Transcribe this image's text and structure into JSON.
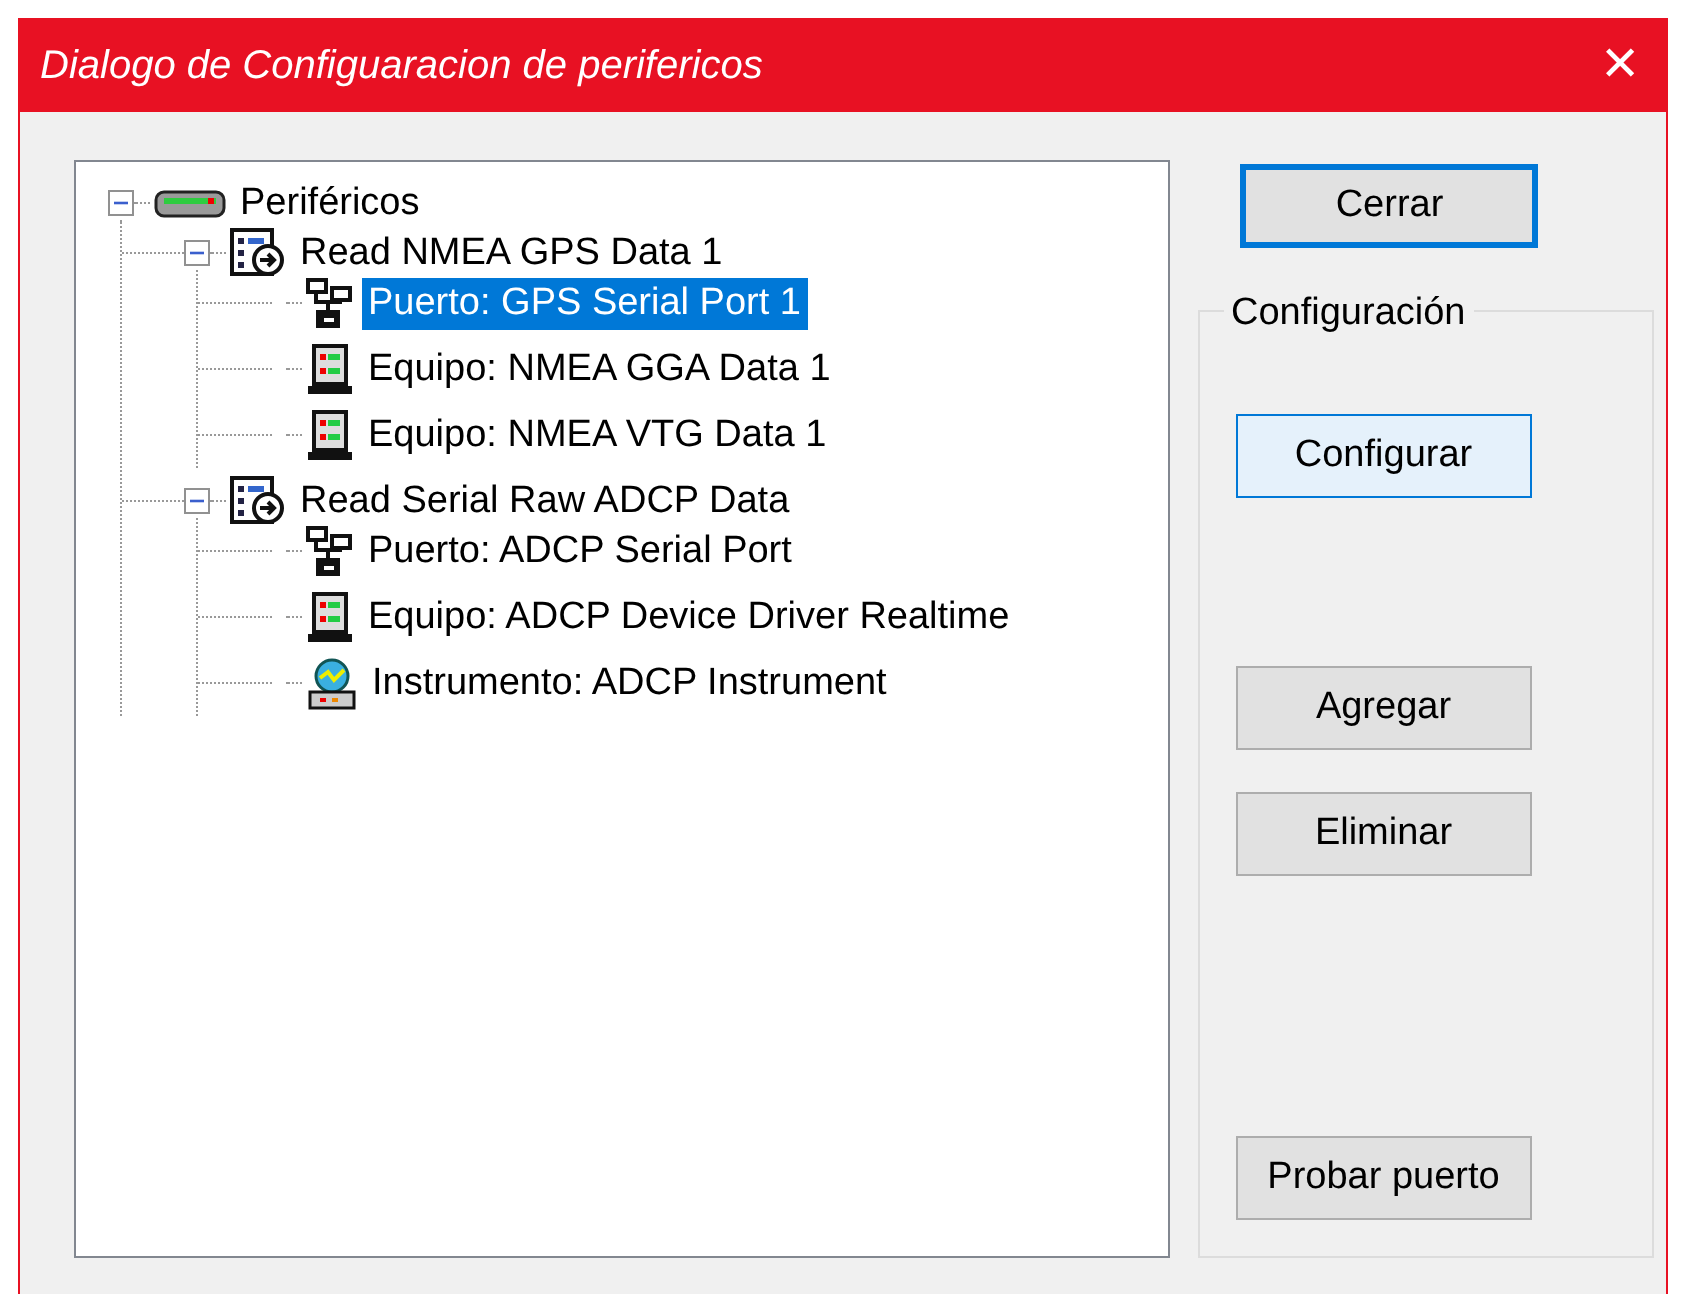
{
  "window": {
    "title": "Dialogo de Configuaracion de perifericos",
    "close": "✕"
  },
  "tree": [
    {
      "label": "Periféricos",
      "kind": "device",
      "selected": false,
      "expanded": true,
      "children": [
        {
          "label": "Read NMEA GPS Data 1",
          "kind": "process",
          "selected": false,
          "expanded": true,
          "children": [
            {
              "label": "Puerto: GPS Serial Port 1",
              "kind": "port",
              "selected": true
            },
            {
              "label": "Equipo: NMEA GGA Data 1",
              "kind": "equipment",
              "selected": false
            },
            {
              "label": "Equipo: NMEA VTG Data 1",
              "kind": "equipment",
              "selected": false
            }
          ]
        },
        {
          "label": "Read Serial Raw ADCP Data",
          "kind": "process",
          "selected": false,
          "expanded": true,
          "children": [
            {
              "label": "Puerto: ADCP Serial Port",
              "kind": "port",
              "selected": false
            },
            {
              "label": "Equipo: ADCP Device Driver Realtime",
              "kind": "equipment",
              "selected": false
            },
            {
              "label": "Instrumento: ADCP Instrument",
              "kind": "instrument",
              "selected": false
            }
          ]
        }
      ]
    }
  ],
  "close_button": {
    "label": "Cerrar",
    "focused": true
  },
  "group": {
    "title": "Configuración",
    "buttons": [
      {
        "label": "Configurar",
        "kind": "hover"
      },
      {
        "label": "Agregar",
        "kind": "normal"
      },
      {
        "label": "Eliminar",
        "kind": "normal"
      },
      {
        "label": "Probar puerto",
        "kind": "normal"
      }
    ]
  }
}
